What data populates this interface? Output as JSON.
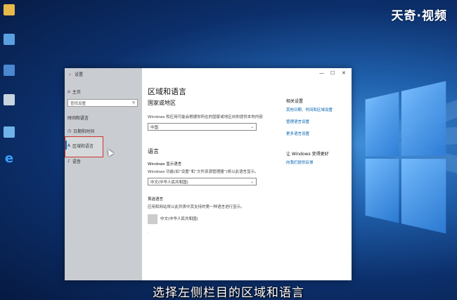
{
  "watermark": "天奇·视频",
  "subtitle": "选择左侧栏目的区域和语言",
  "desktop": {
    "icons": [
      "icon-1",
      "icon-2",
      "icon-3",
      "icon-4",
      "icon-5",
      "ie-icon"
    ]
  },
  "window": {
    "back_arrow": "‹",
    "app_title": "设置",
    "controls": {
      "minimize": "—",
      "maximize": "☐",
      "close": "✕"
    },
    "sidebar": {
      "home": "主页",
      "search_placeholder": "查找设置",
      "section_title": "时间和语言",
      "items": [
        {
          "label": "日期和时间"
        },
        {
          "label": "区域和语言"
        },
        {
          "label": "语音"
        }
      ]
    },
    "main": {
      "title": "区域和语言",
      "country_heading": "国家或地区",
      "country_desc": "Windows 和应用可能会根据你所在的国家或地区向你提供本地内容",
      "country_value": "中国",
      "language_heading": "语言",
      "display_lang_label": "Windows 显示语言",
      "display_lang_desc": "Windows 功能(如“设置”和“文件资源管理器”)将以此语言显示。",
      "display_lang_value": "中文(中华人民共和国)",
      "preferred_lang_label": "首选语言",
      "preferred_lang_desc": "应用和网站将以此列表中其支持的第一种语言进行显示。",
      "lang_item": "中文(中华人民共和国)",
      "related_heading": "相关设置",
      "related_links": [
        "其他日期、时间和区域设置",
        "管理语言设置",
        "更多语言设置"
      ],
      "help_heading": "让 Windows 变得更好",
      "help_link": "向我们提供反馈"
    }
  }
}
